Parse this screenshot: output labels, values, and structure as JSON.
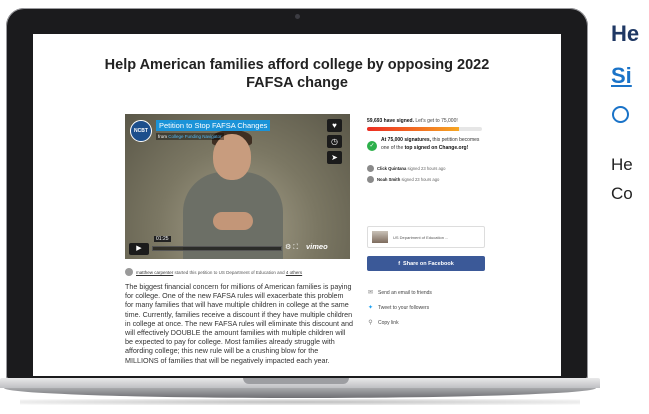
{
  "petition": {
    "title": "Help American families afford college by opposing 2022 FAFSA change",
    "video": {
      "logo": "NCBT",
      "title": "Petition to Stop FAFSA Changes",
      "from_prefix": "from",
      "from_name": "College Funding Navigator",
      "timecode": "01:25",
      "brand": "vimeo",
      "icons": [
        "heart-icon",
        "clock-icon",
        "send-icon",
        "play-icon"
      ]
    },
    "starter": {
      "name": "matthew carpenter",
      "text": "started this petition to US Department of Education and",
      "others": "4 others"
    },
    "body": "The biggest financial concern for millions of American families is paying for college.  One of the new FAFSA rules will exacerbate this problem for many families that will have multiple children in college at the same time.  Currently, families receive a discount if they have multiple children in college at once.  The new FAFSA rules will eliminate this discount and will effectively DOUBLE the amount families with multiple children will be expected to pay for college.  Most families already struggle with affording college; this new rule will be a crushing blow for the MILLIONS of families that will be negatively impacted each year."
  },
  "sidebar": {
    "signed_count": "59,693 have signed.",
    "goal_text": "Let's get to 75,000!",
    "progress_fraction": 0.796,
    "milestone_bold": "At 75,000 signatures,",
    "milestone_text": "this petition becomes one of the",
    "milestone_bold2": "top signed on Change.org!",
    "signers": [
      {
        "name": "Click Quintana",
        "time": "signed 23 hours ago"
      },
      {
        "name": "Noah Smith",
        "time": "signed 23 hours ago"
      }
    ],
    "decision_maker": "US Department of Education ...",
    "facebook_label": "Share on Facebook",
    "share_email": "Send an email to friends",
    "share_twitter": "Tweet to your followers",
    "copy_link": "Copy link"
  },
  "slide": {
    "title_line1": "He",
    "title_line2": "Si",
    "body_line1": "He",
    "body_line2": "Co"
  },
  "colors": {
    "slide_title": "#1f3864",
    "slide_link": "#1a73c8",
    "facebook": "#3b5998",
    "progress_start": "#ec2c22",
    "progress_end": "#f6a623"
  }
}
